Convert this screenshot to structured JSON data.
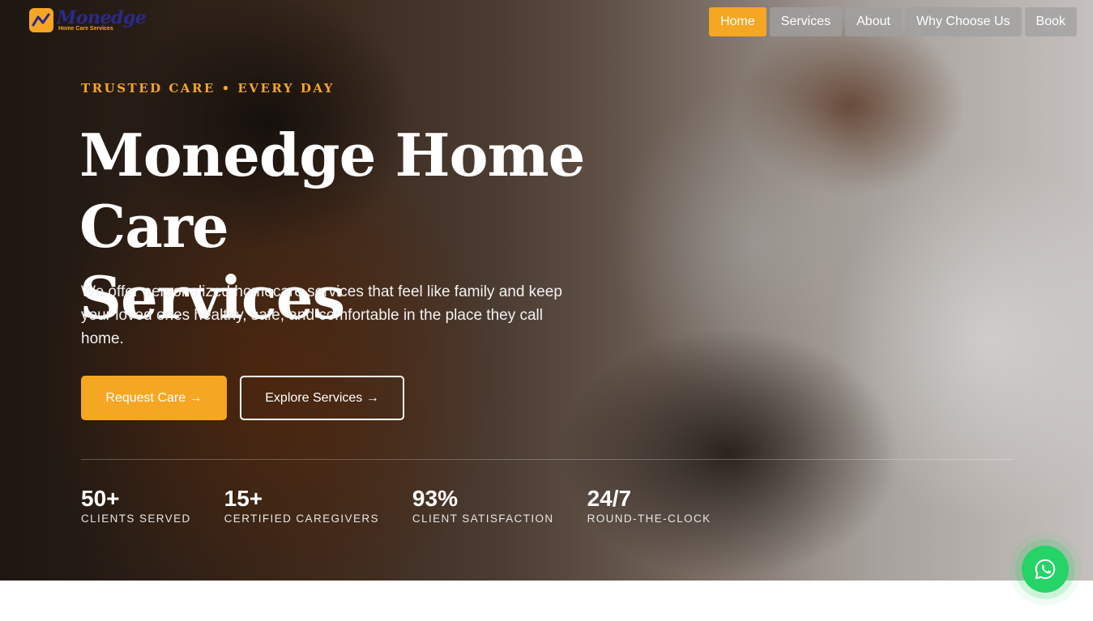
{
  "brand": {
    "name": "Monedge",
    "tagline": "Home Care Services",
    "accent": "#f5a623",
    "brand_blue": "#2a2a8a"
  },
  "nav": {
    "items": [
      {
        "label": "Home",
        "active": true
      },
      {
        "label": "Services",
        "active": false
      },
      {
        "label": "About",
        "active": false
      },
      {
        "label": "Why Choose Us",
        "active": false
      },
      {
        "label": "Book",
        "active": false
      }
    ]
  },
  "hero": {
    "eyebrow": "TRUSTED CARE • EVERY DAY",
    "title_line1": "Monedge Home Care",
    "title_line2": "Services",
    "subtitle": "We offer personalized homecare services that feel like family and keep your loved ones healthy, safe, and comfortable in the place they call home.",
    "primary_cta": "Request Care →",
    "secondary_cta": "Explore Services →"
  },
  "stats": [
    {
      "value": "50+",
      "label": "CLIENTS SERVED"
    },
    {
      "value": "15+",
      "label": "CERTIFIED CAREGIVERS"
    },
    {
      "value": "93%",
      "label": "CLIENT SATISFACTION"
    },
    {
      "value": "24/7",
      "label": "ROUND-THE-CLOCK"
    }
  ],
  "floating": {
    "icon": "whatsapp-icon",
    "color": "#25d366"
  }
}
